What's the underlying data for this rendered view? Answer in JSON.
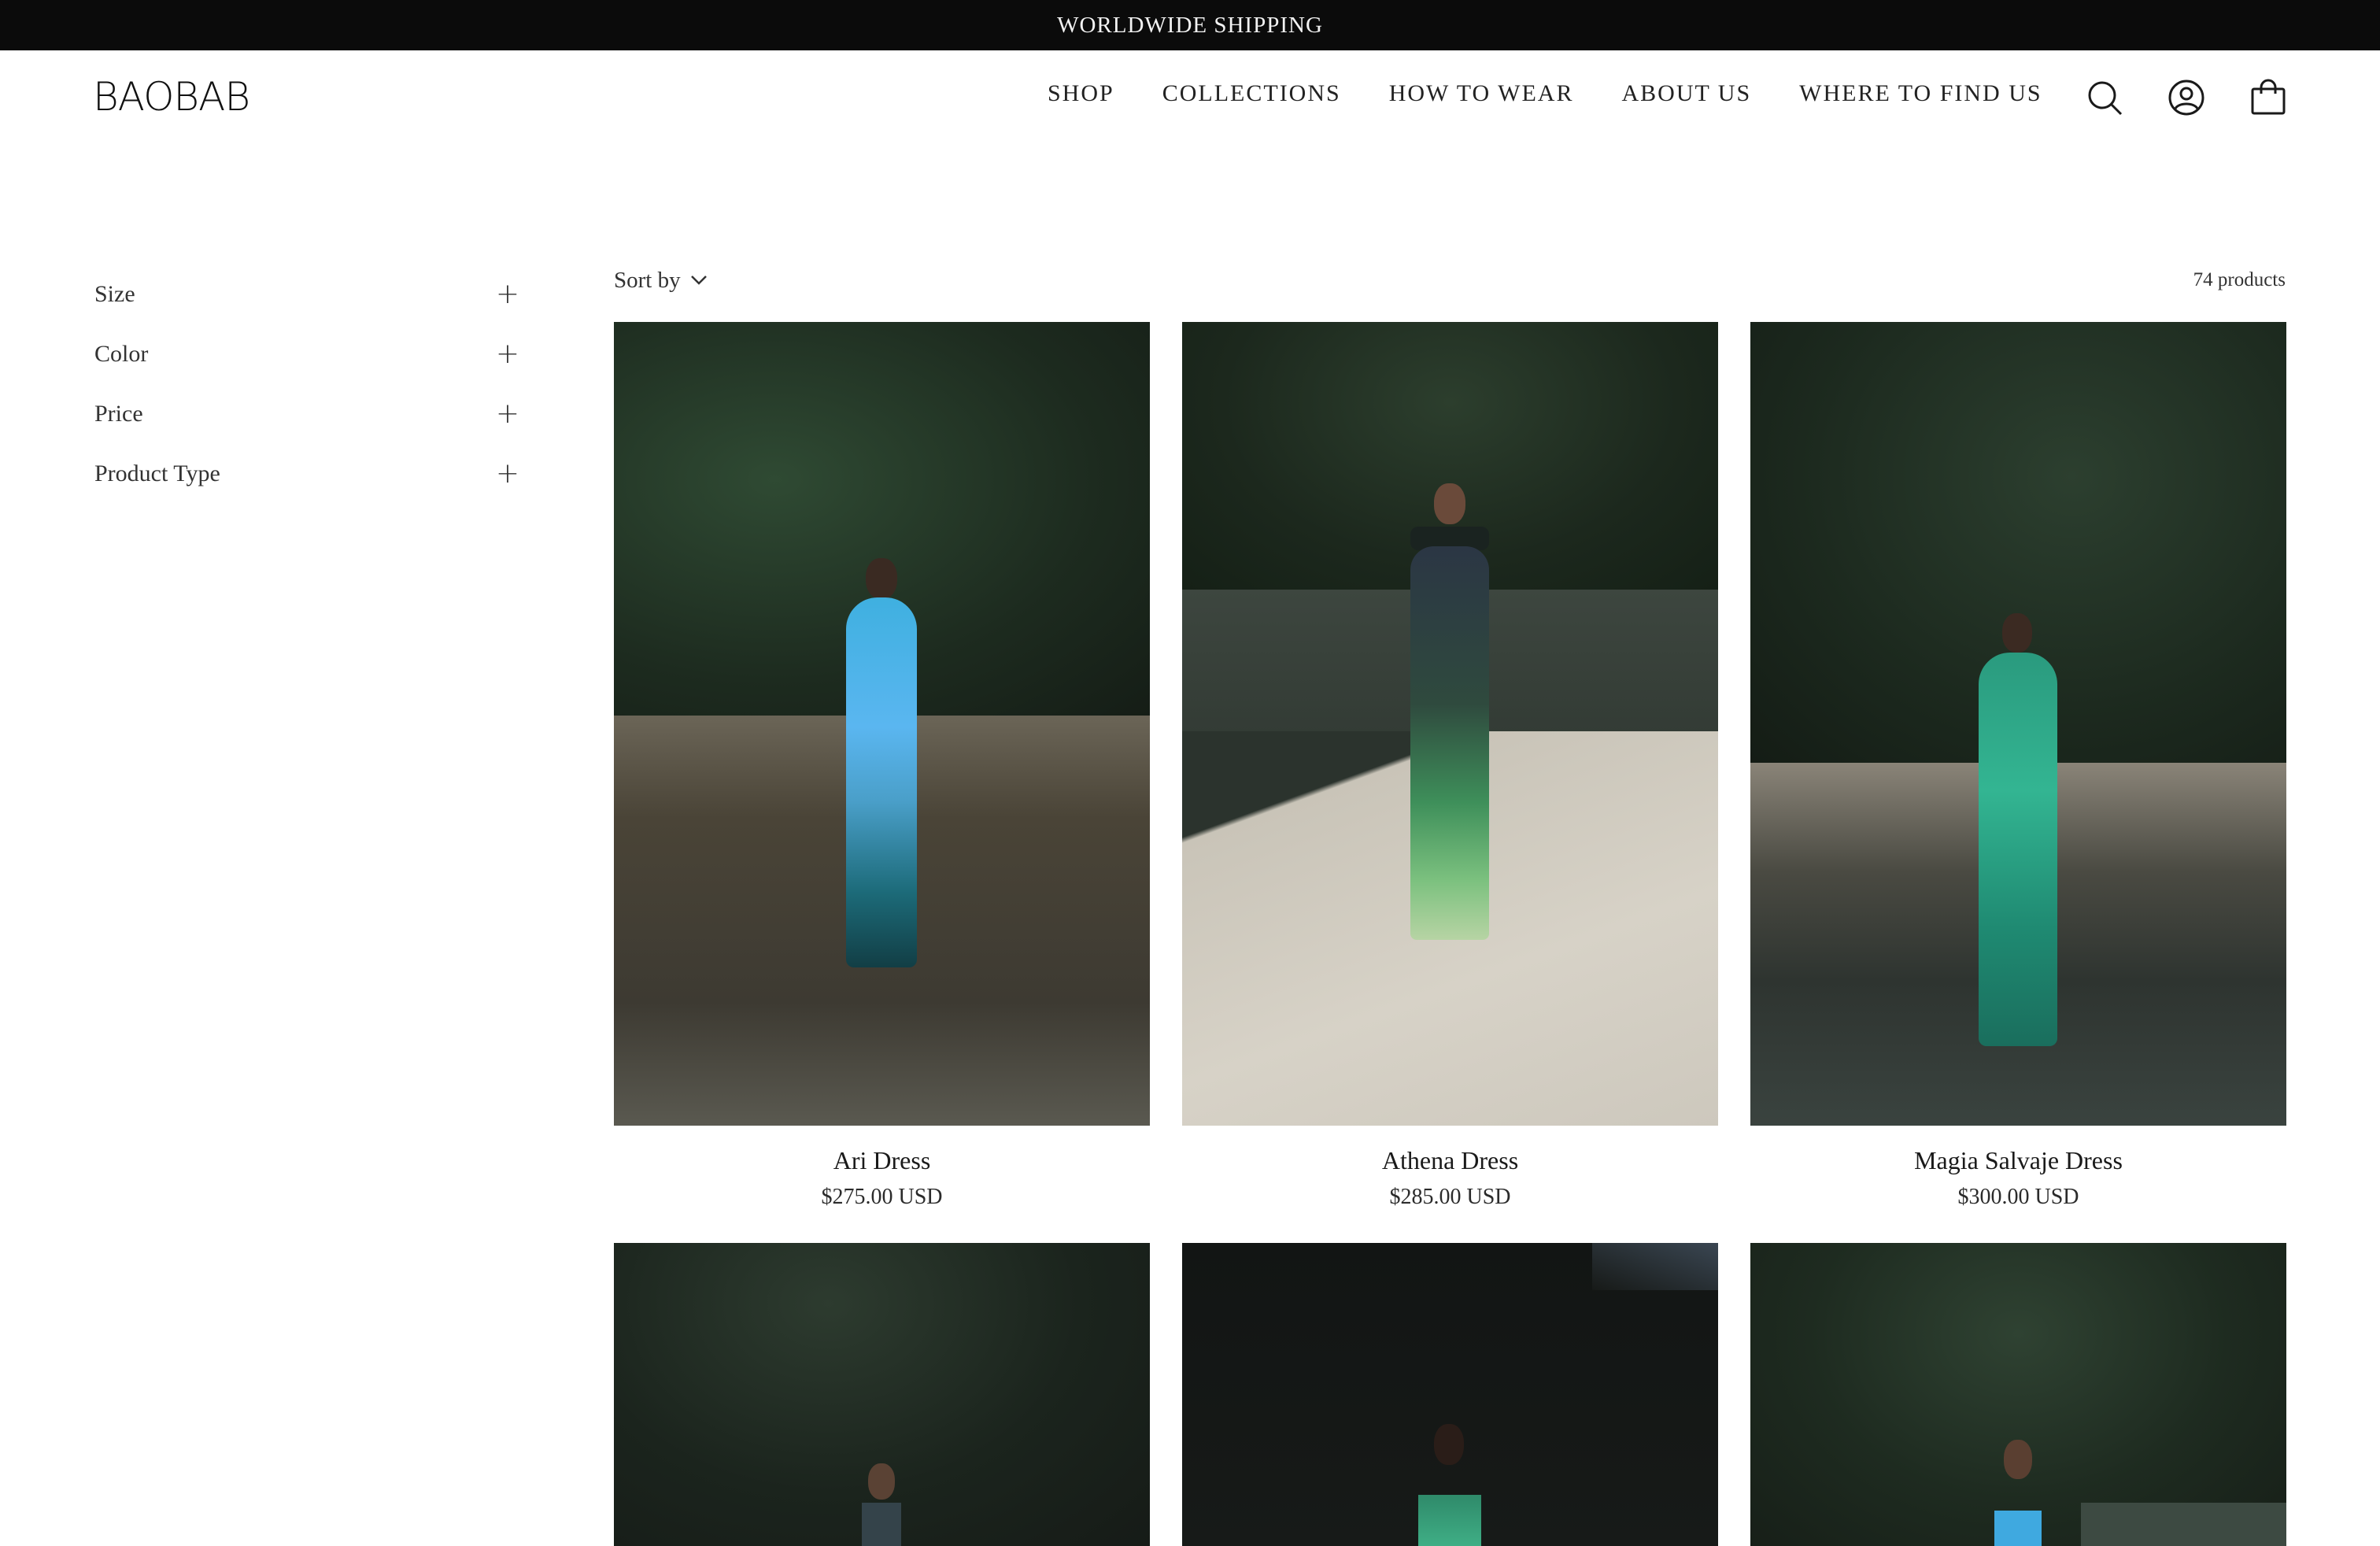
{
  "announcement": "WORLDWIDE SHIPPING",
  "brand": "BAOBAB",
  "nav": [
    "SHOP",
    "COLLECTIONS",
    "HOW TO WEAR",
    "ABOUT US",
    "WHERE TO FIND US"
  ],
  "header_icons": [
    "search-icon",
    "account-icon",
    "cart-icon"
  ],
  "filters": [
    "Size",
    "Color",
    "Price",
    "Product Type"
  ],
  "sort_label": "Sort by",
  "product_count": "74 products",
  "products": [
    {
      "name": "Ari Dress",
      "price": "$275.00 USD"
    },
    {
      "name": "Athena Dress",
      "price": "$285.00 USD"
    },
    {
      "name": "Magia Salvaje Dress",
      "price": "$300.00 USD"
    }
  ],
  "colors": {
    "announcement_bg": "#0b0b0b",
    "text": "#1a1a1a",
    "background": "#ffffff"
  }
}
